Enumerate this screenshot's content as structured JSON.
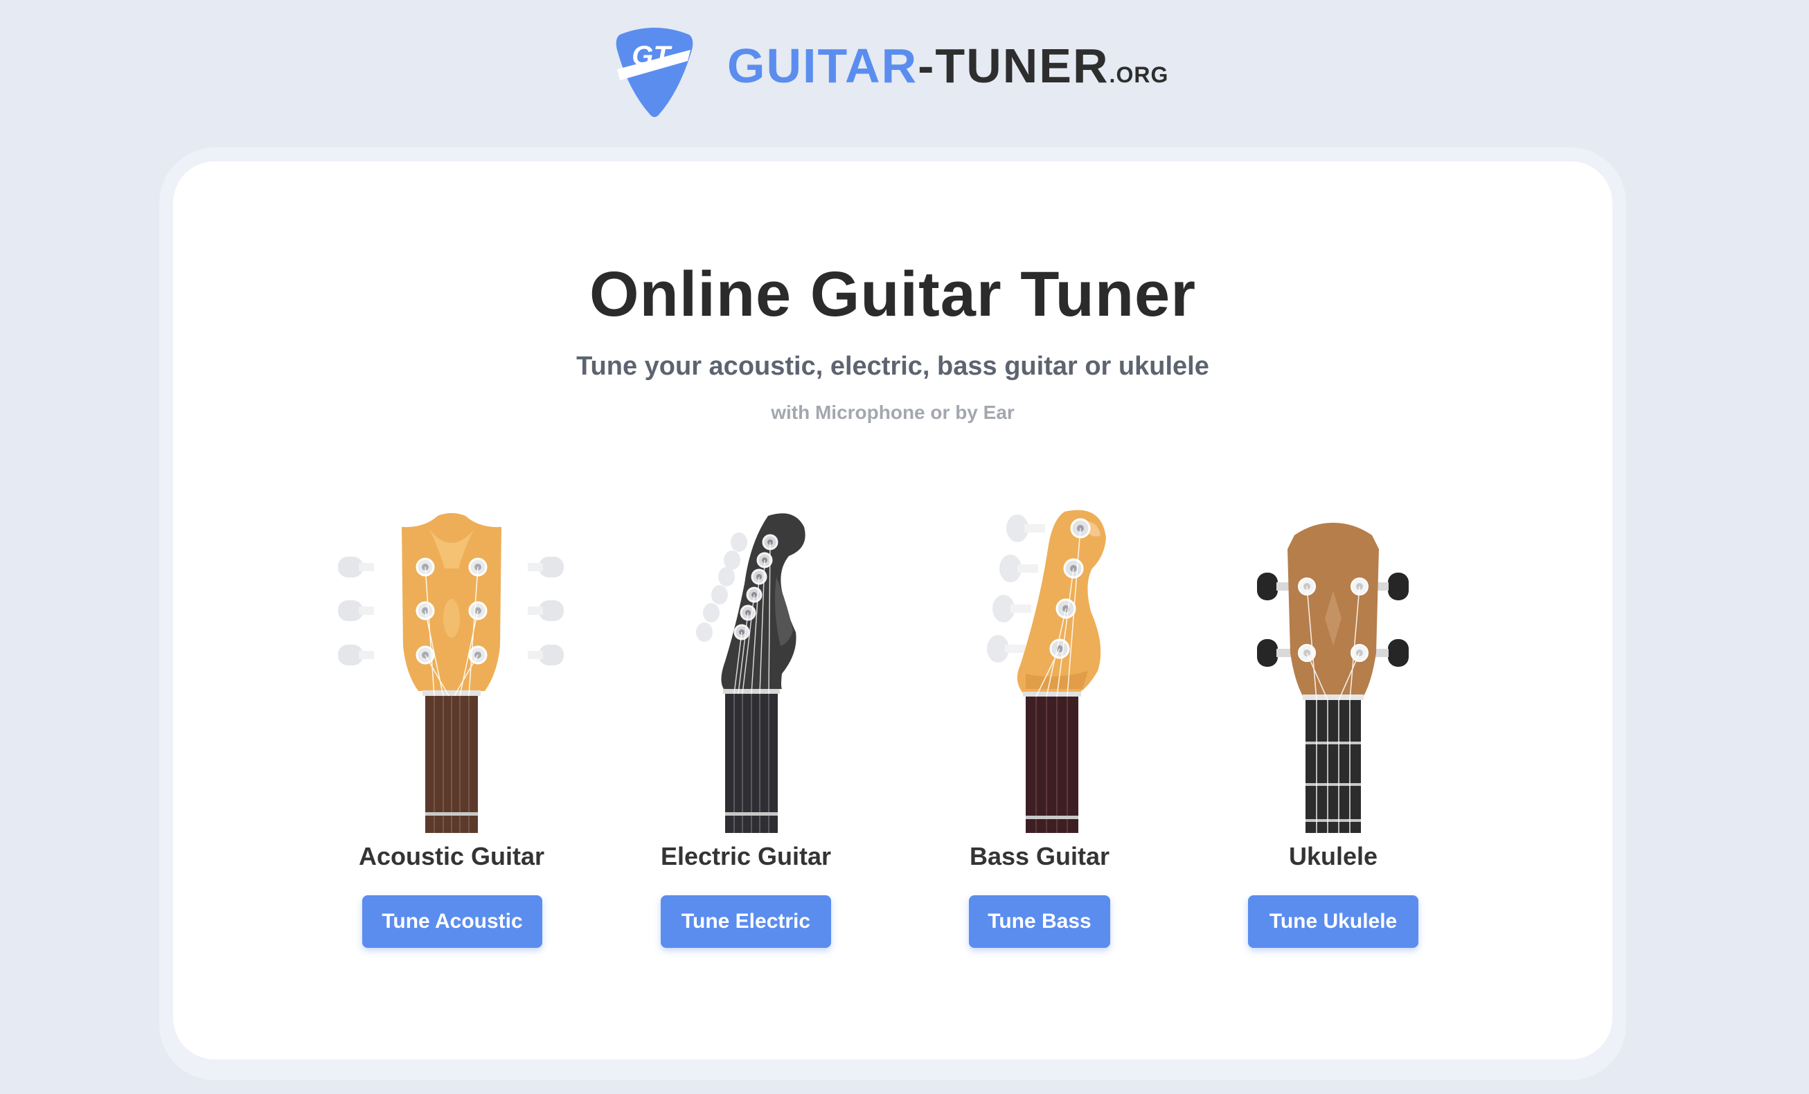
{
  "header": {
    "logo_monogram": "GT",
    "logo_text_part1": "GUITAR",
    "logo_text_part2": "-TUNER",
    "logo_text_suffix": ".ORG"
  },
  "main": {
    "title": "Online Guitar Tuner",
    "subtitle": "Tune your acoustic, electric, bass guitar or ukulele",
    "subtitle_secondary": "with Microphone or by Ear"
  },
  "instruments": [
    {
      "name": "Acoustic Guitar",
      "button_label": "Tune Acoustic",
      "icon": "acoustic-headstock-icon"
    },
    {
      "name": "Electric Guitar",
      "button_label": "Tune Electric",
      "icon": "electric-headstock-icon"
    },
    {
      "name": "Bass Guitar",
      "button_label": "Tune Bass",
      "icon": "bass-headstock-icon"
    },
    {
      "name": "Ukulele",
      "button_label": "Tune Ukulele",
      "icon": "ukulele-headstock-icon"
    }
  ],
  "colors": {
    "page_background": "#e5eaf3",
    "card_background": "#ffffff",
    "accent_blue": "#5b8def",
    "title_text": "#2b2b2b",
    "acoustic_wood": "#eeae57",
    "electric_body": "#3c3c3c",
    "ukulele_wood": "#b57e4b"
  }
}
